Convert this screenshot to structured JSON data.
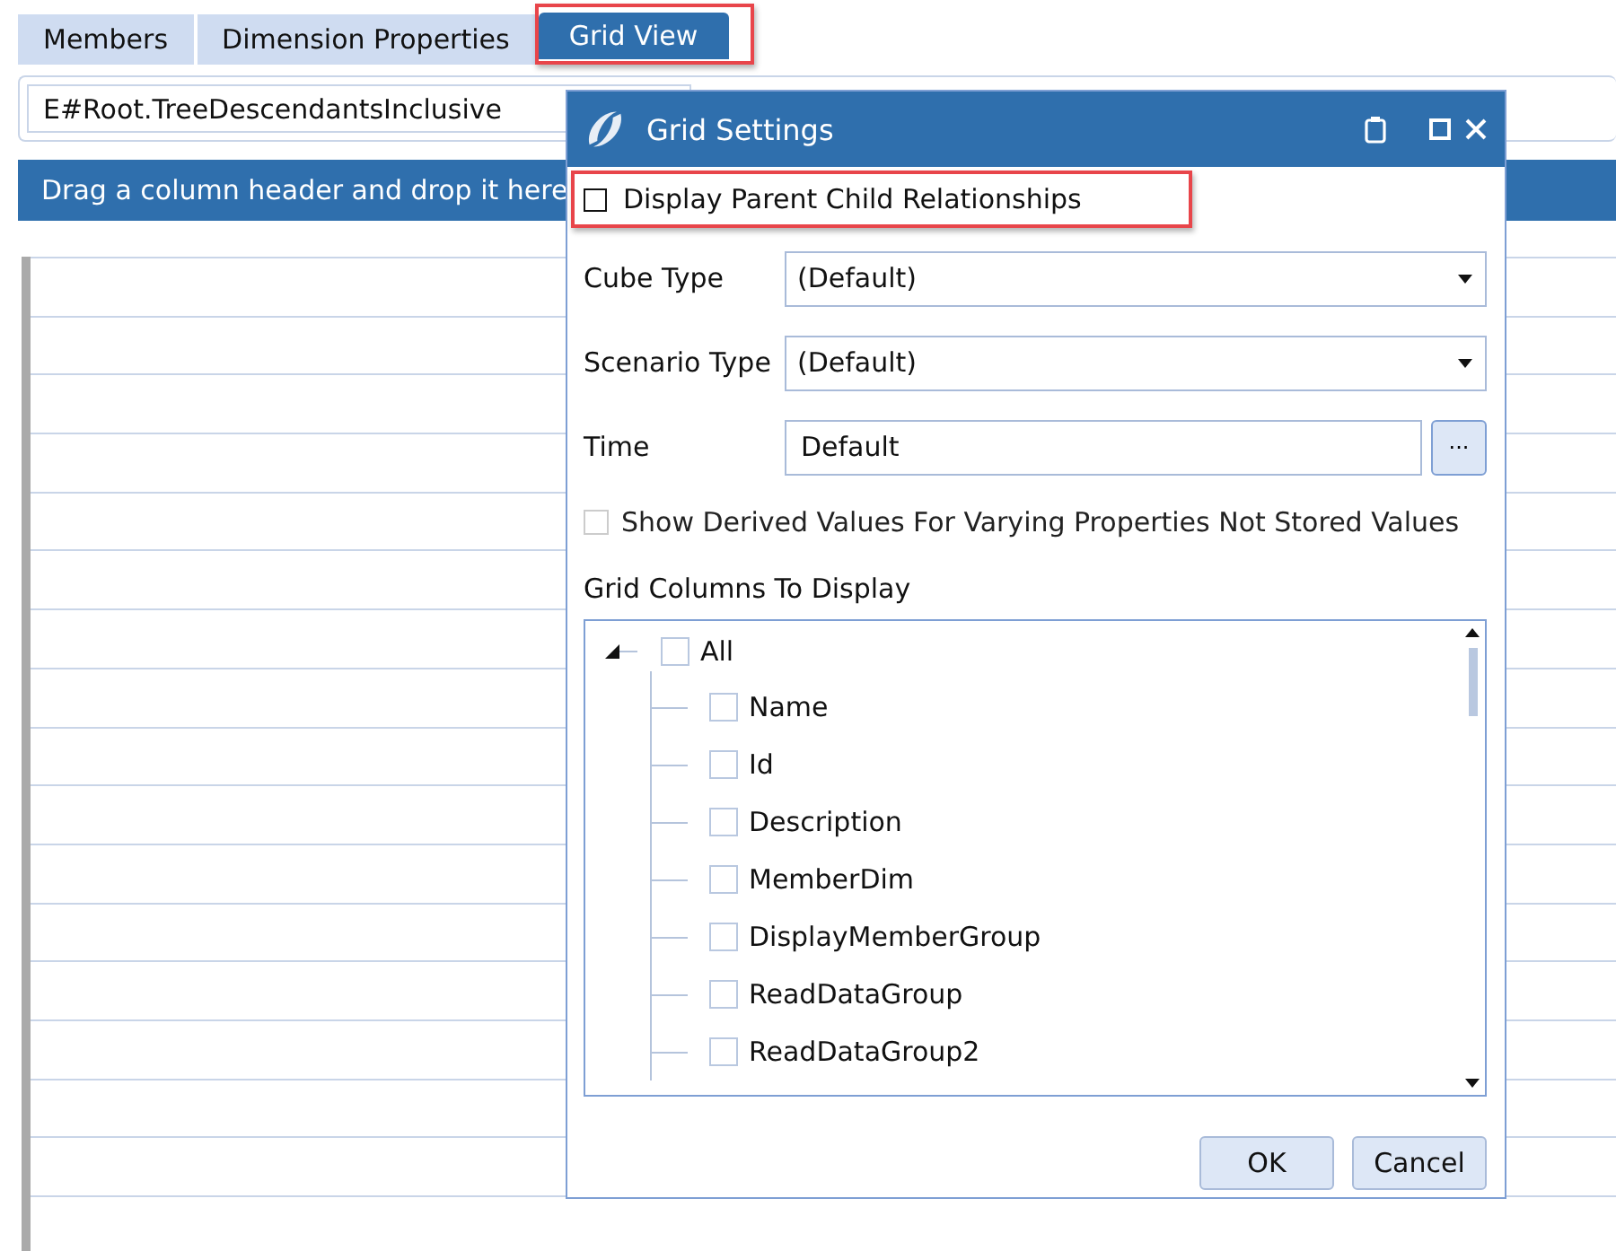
{
  "tabs": [
    {
      "label": "Members",
      "selected": false,
      "highlighted": false
    },
    {
      "label": "Dimension Properties",
      "selected": false,
      "highlighted": false
    },
    {
      "label": "Grid View",
      "selected": true,
      "highlighted": true
    }
  ],
  "filter": {
    "value": "E#Root.TreeDescendantsInclusive"
  },
  "group_panel": {
    "text": "Drag a column header and drop it here"
  },
  "dialog": {
    "title": "Grid Settings",
    "parent_child": {
      "label": "Display Parent Child Relationships",
      "checked": false,
      "highlighted": true
    },
    "fields": [
      {
        "kind": "dropdown",
        "label": "Cube Type",
        "value": "(Default)"
      },
      {
        "kind": "dropdown",
        "label": "Scenario Type",
        "value": "(Default)"
      },
      {
        "kind": "picker",
        "label": "Time",
        "value": "Default",
        "button": "..."
      }
    ],
    "show_derived": {
      "label": "Show Derived Values For Varying Properties Not Stored Values",
      "checked": false,
      "disabled": true
    },
    "columns_label": "Grid Columns To Display",
    "columns_tree": [
      {
        "label": "All",
        "checked": false,
        "expanded": true,
        "children": [
          {
            "label": "Name",
            "checked": false
          },
          {
            "label": "Id",
            "checked": false
          },
          {
            "label": "Description",
            "checked": false
          },
          {
            "label": "MemberDim",
            "checked": false
          },
          {
            "label": "DisplayMemberGroup",
            "checked": false
          },
          {
            "label": "ReadDataGroup",
            "checked": false
          },
          {
            "label": "ReadDataGroup2",
            "checked": false
          }
        ]
      }
    ],
    "buttons": [
      "OK",
      "Cancel"
    ]
  }
}
